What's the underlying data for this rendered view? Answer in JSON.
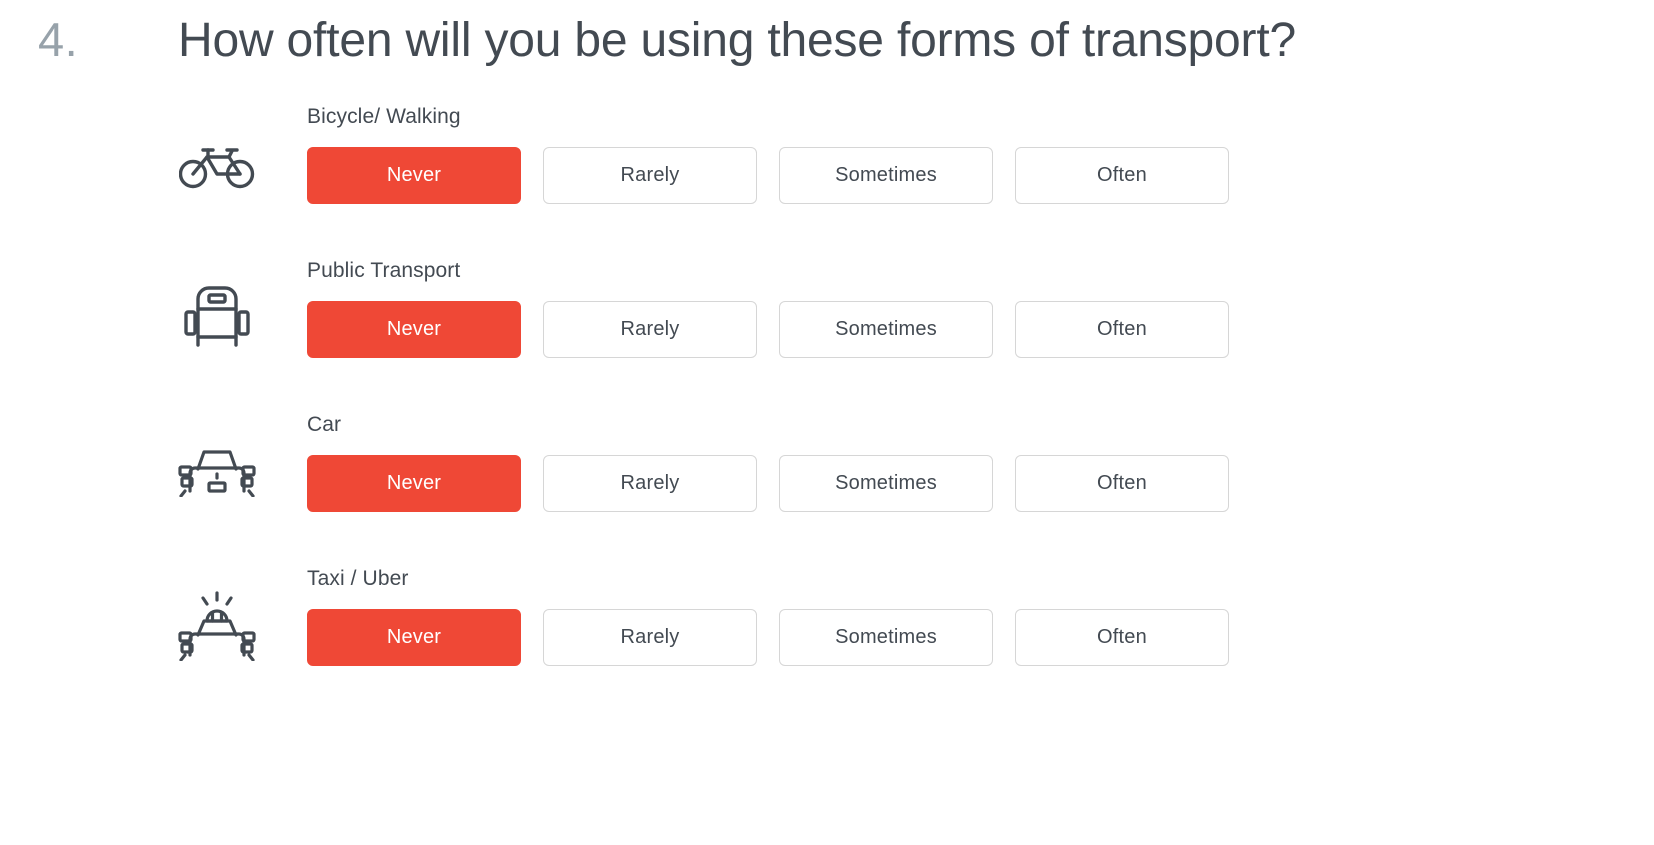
{
  "question": {
    "number": "4.",
    "title": "How often will you be using these forms of transport?"
  },
  "colors": {
    "selected_background": "#ef4836",
    "selected_text": "#ffffff",
    "button_border": "#d6d6d6",
    "text": "#434a52",
    "number": "#97a2aa",
    "icon": "#434a52"
  },
  "options": [
    "Never",
    "Rarely",
    "Sometimes",
    "Often"
  ],
  "rows": [
    {
      "icon": "bicycle-icon",
      "label": "Bicycle/ Walking",
      "selected": "Never",
      "options": [
        {
          "label": "Never",
          "selected": true
        },
        {
          "label": "Rarely",
          "selected": false
        },
        {
          "label": "Sometimes",
          "selected": false
        },
        {
          "label": "Often",
          "selected": false
        }
      ]
    },
    {
      "icon": "bus-icon",
      "label": "Public Transport",
      "selected": "Never",
      "options": [
        {
          "label": "Never",
          "selected": true
        },
        {
          "label": "Rarely",
          "selected": false
        },
        {
          "label": "Sometimes",
          "selected": false
        },
        {
          "label": "Often",
          "selected": false
        }
      ]
    },
    {
      "icon": "car-icon",
      "label": "Car",
      "selected": "Never",
      "options": [
        {
          "label": "Never",
          "selected": true
        },
        {
          "label": "Rarely",
          "selected": false
        },
        {
          "label": "Sometimes",
          "selected": false
        },
        {
          "label": "Often",
          "selected": false
        }
      ]
    },
    {
      "icon": "taxi-icon",
      "label": "Taxi / Uber",
      "selected": "Never",
      "options": [
        {
          "label": "Never",
          "selected": true
        },
        {
          "label": "Rarely",
          "selected": false
        },
        {
          "label": "Sometimes",
          "selected": false
        },
        {
          "label": "Often",
          "selected": false
        }
      ]
    }
  ]
}
